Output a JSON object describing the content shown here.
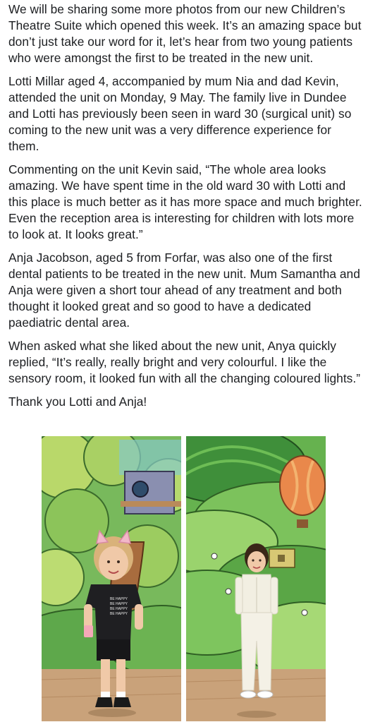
{
  "post": {
    "paragraphs": [
      "We will be sharing some more photos from our new Children’s Theatre Suite which opened this week. It’s an amazing space but don’t just take our word for it, let’s hear from two young patients who were amongst the first to be treated in the new unit.",
      "Lotti Millar aged 4, accompanied by mum Nia and dad Kevin, attended the unit on Monday, 9 May. The family live in Dundee and Lotti has previously been seen in ward 30 (surgical unit) so coming to the new unit was a very difference experience for them.",
      "Commenting on the unit Kevin said, “The whole area looks amazing. We have spent time in the old ward 30 with Lotti and this place is much better as it has more space and much brighter. Even the reception area is interesting for children with lots more to look at. It looks great.”",
      "Anja Jacobson, aged 5 from Forfar, was also one of the first dental patients to be treated in the new unit. Mum Samantha and Anja were given a short tour ahead of any treatment and both thought it looked great and so good to have a dedicated paediatric dental area.",
      "When asked what she liked about the new unit, Anya quickly replied, “It’s really, really bright and very colourful. I like the sensory room, it looked fun with all the changing coloured lights.”",
      "Thank you Lotti and Anja!"
    ],
    "shirt_text": "BE HAPPY"
  },
  "colors": {
    "text": "#1c1e21",
    "mural_green": "#6fb457",
    "floor": "#c9a27a"
  }
}
